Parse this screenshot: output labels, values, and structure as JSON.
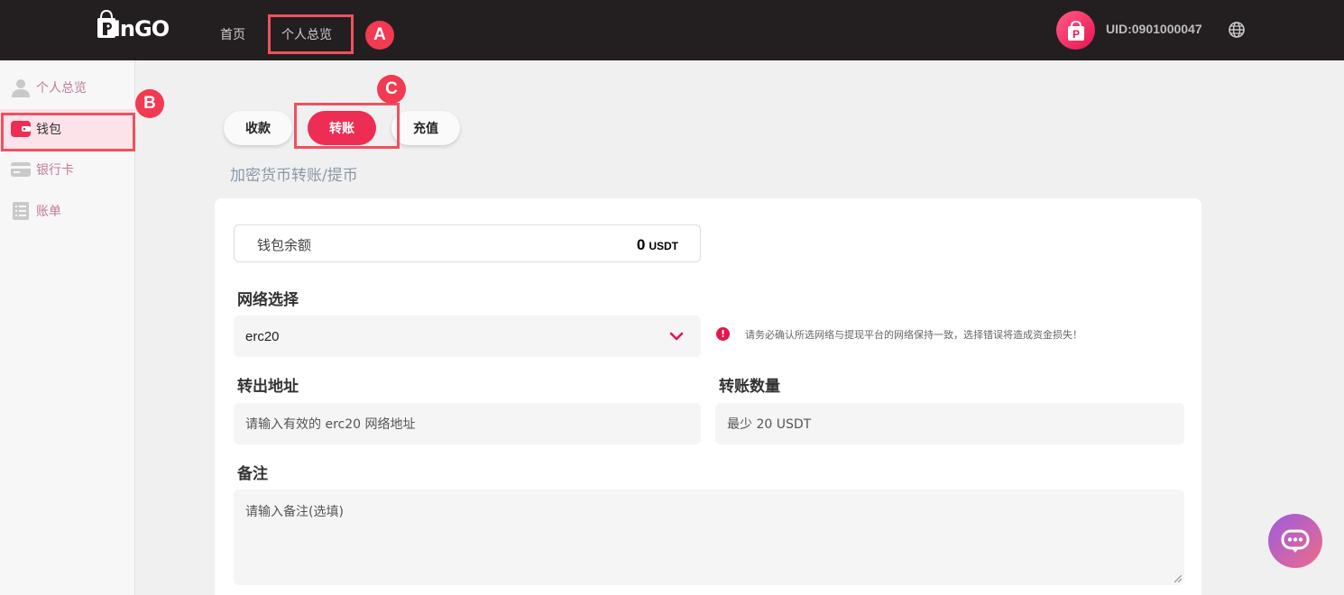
{
  "header": {
    "logo_text": "PinGO",
    "nav": [
      {
        "label": "首页"
      },
      {
        "label": "个人总览"
      }
    ],
    "uid": "UID:0901000047",
    "avatar_letter": "P",
    "language_icon": "globe-icon"
  },
  "markers": {
    "a": "A",
    "b": "B",
    "c": "C"
  },
  "sidebar": {
    "items": [
      {
        "label": "个人总览",
        "icon": "user-icon"
      },
      {
        "label": "钱包",
        "icon": "wallet-icon"
      },
      {
        "label": "银行卡",
        "icon": "card-icon"
      },
      {
        "label": "账单",
        "icon": "bill-icon"
      }
    ]
  },
  "tabs": [
    {
      "label": "收款"
    },
    {
      "label": "转账"
    },
    {
      "label": "充值"
    }
  ],
  "section_title": "加密货币转账/提币",
  "form": {
    "balance_label": "钱包余额",
    "balance_value": "0",
    "balance_unit": "USDT",
    "network_label": "网络选择",
    "network_value": "erc20",
    "warning": "请务必确认所选网络与提现平台的网络保持一致，选择错误将造成资金损失！",
    "address_label": "转出地址",
    "address_placeholder": "请输入有效的 erc20 网络地址",
    "amount_label": "转账数量",
    "amount_placeholder": "最少 20 USDT",
    "note_label": "备注",
    "note_placeholder": "请输入备注(选填)"
  },
  "colors": {
    "accent": "#ee2d55",
    "topbar": "#231f20",
    "marker": "#f23a52"
  }
}
